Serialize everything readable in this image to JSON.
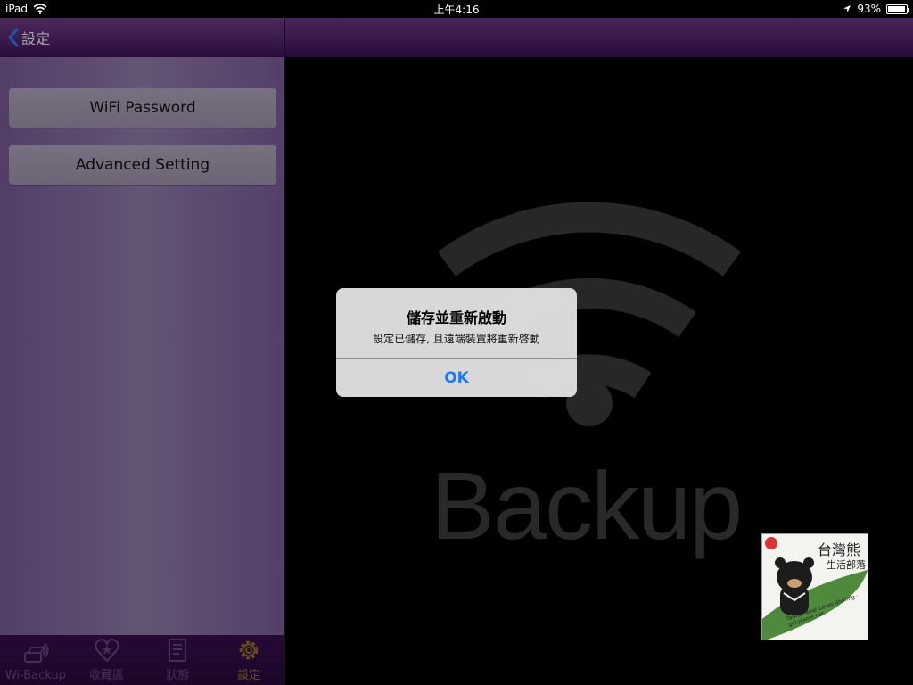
{
  "status_bar": {
    "device": "iPad",
    "time": "上午4:16",
    "battery_text": "93%",
    "battery_level": 0.93
  },
  "left_nav": {
    "back_label": "設定"
  },
  "settings_menu": {
    "items": [
      {
        "label": "WiFi Password"
      },
      {
        "label": "Advanced Setting"
      }
    ]
  },
  "tab_bar": {
    "tabs": [
      {
        "label": "Wi-Backup",
        "icon": "wi-backup-icon"
      },
      {
        "label": "收藏區",
        "icon": "heart-star-icon"
      },
      {
        "label": "狀態",
        "icon": "document-icon"
      },
      {
        "label": "設定",
        "icon": "gear-icon",
        "active": true
      }
    ]
  },
  "main": {
    "logo_word": "Backup"
  },
  "alert": {
    "title": "儲存並重新啟動",
    "message": "設定已儲存, 且遠端裝置將重新啓動",
    "ok_label": "OK"
  },
  "watermark": {
    "title": "台灣熊",
    "subtitle": "生活部落",
    "note": "Taiwan Bear Loves Sharing · girl.pixnet.net"
  },
  "colors": {
    "nav_purple": "#5a2878",
    "panel_lavender": "#9a82b3",
    "alert_blue": "#1a7cf0",
    "tab_active": "#a07a2a"
  }
}
